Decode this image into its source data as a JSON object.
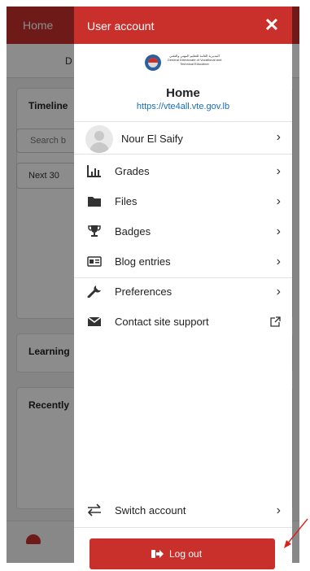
{
  "background": {
    "home_label": "Home",
    "tab_label": "D",
    "timeline_title": "Timeline",
    "search_placeholder": "Search b",
    "next_select": "Next 30",
    "learning_title": "Learning",
    "recently_title": "Recently"
  },
  "drawer": {
    "title": "User account",
    "close_symbol": "✕",
    "site": {
      "logo_text": "المديرية العامة للتعليم المهني والتقني General Directorate of Vocational and Technical Education",
      "name": "Home",
      "url": "https://vte4all.vte.gov.lb"
    },
    "user": {
      "name": "Nour El Saify"
    },
    "menu_items": [
      {
        "label": "Grades",
        "icon": "bar-chart-icon",
        "trailing": "›"
      },
      {
        "label": "Files",
        "icon": "folder-icon",
        "trailing": "›"
      },
      {
        "label": "Badges",
        "icon": "trophy-icon",
        "trailing": "›"
      },
      {
        "label": "Blog entries",
        "icon": "blog-icon",
        "trailing": "›"
      }
    ],
    "settings_items": [
      {
        "label": "Preferences",
        "icon": "wrench-icon",
        "trailing": "›"
      },
      {
        "label": "Contact site support",
        "icon": "envelope-icon",
        "trailing": "external-link-icon"
      }
    ],
    "switch_account": {
      "label": "Switch account",
      "icon": "switch-icon"
    },
    "logout_label": "Log out",
    "chevron": "›"
  },
  "colors": {
    "brand_red": "#c9302c",
    "link_blue": "#1a6eb5",
    "arrow_red": "#d9221c"
  }
}
